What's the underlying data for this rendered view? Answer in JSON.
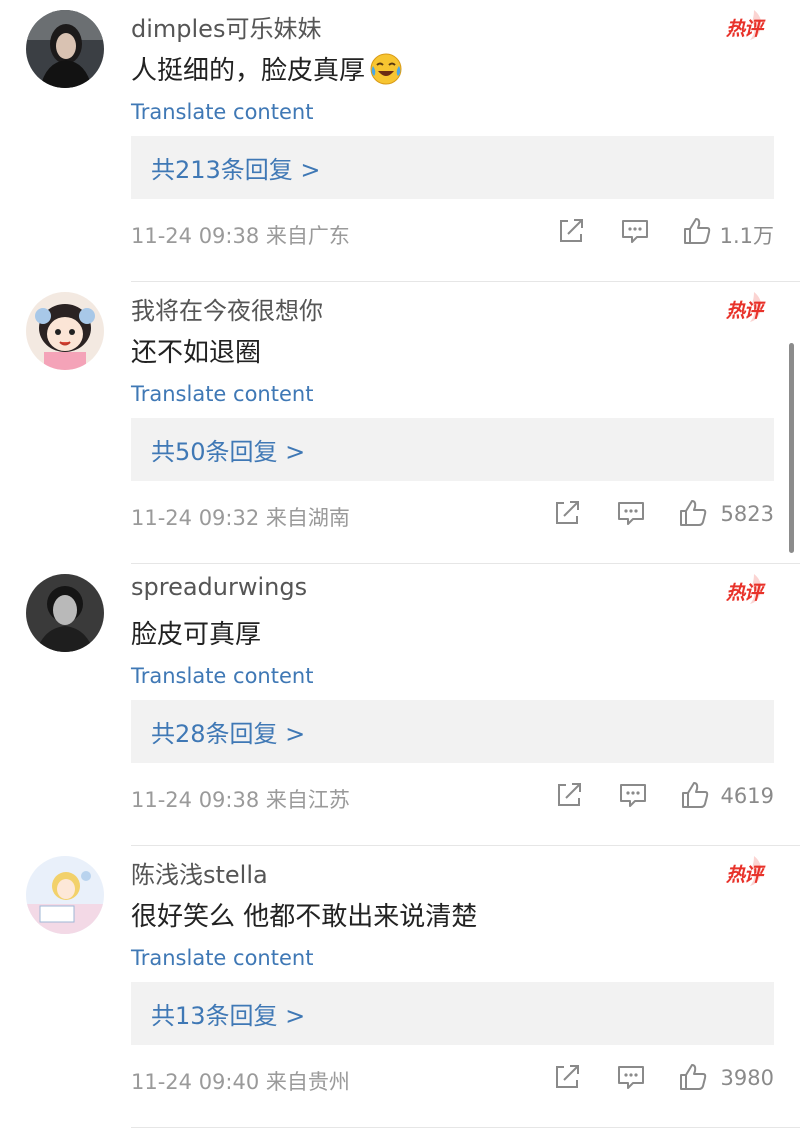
{
  "colors": {
    "link": "#3f78b5",
    "hot": "#e8322a",
    "reply_bg": "#f2f2f2"
  },
  "comments": [
    {
      "username": "dimples可乐妹妹",
      "text": "人挺细的，脸皮真厚",
      "emoji": "laugh-cry-emoji",
      "hot_label": "热评",
      "translate": "Translate content",
      "replies": "共213条回复 >",
      "meta": "11-24 09:38  来自广东",
      "likes": "1.1万"
    },
    {
      "username": "我将在今夜很想你",
      "text": "还不如退圈",
      "hot_label": "热评",
      "translate": "Translate content",
      "replies": "共50条回复 >",
      "meta": "11-24 09:32  来自湖南",
      "likes": "5823"
    },
    {
      "username": "spreadurwings",
      "text": "脸皮可真厚",
      "hot_label": "热评",
      "translate": "Translate content",
      "replies": "共28条回复 >",
      "meta": "11-24 09:38  来自江苏",
      "likes": "4619"
    },
    {
      "username": "陈浅浅stella",
      "text": "很好笑么 他都不敢出来说清楚",
      "hot_label": "热评",
      "translate": "Translate content",
      "replies": "共13条回复 >",
      "meta": "11-24 09:40  来自贵州",
      "likes": "3980"
    }
  ]
}
